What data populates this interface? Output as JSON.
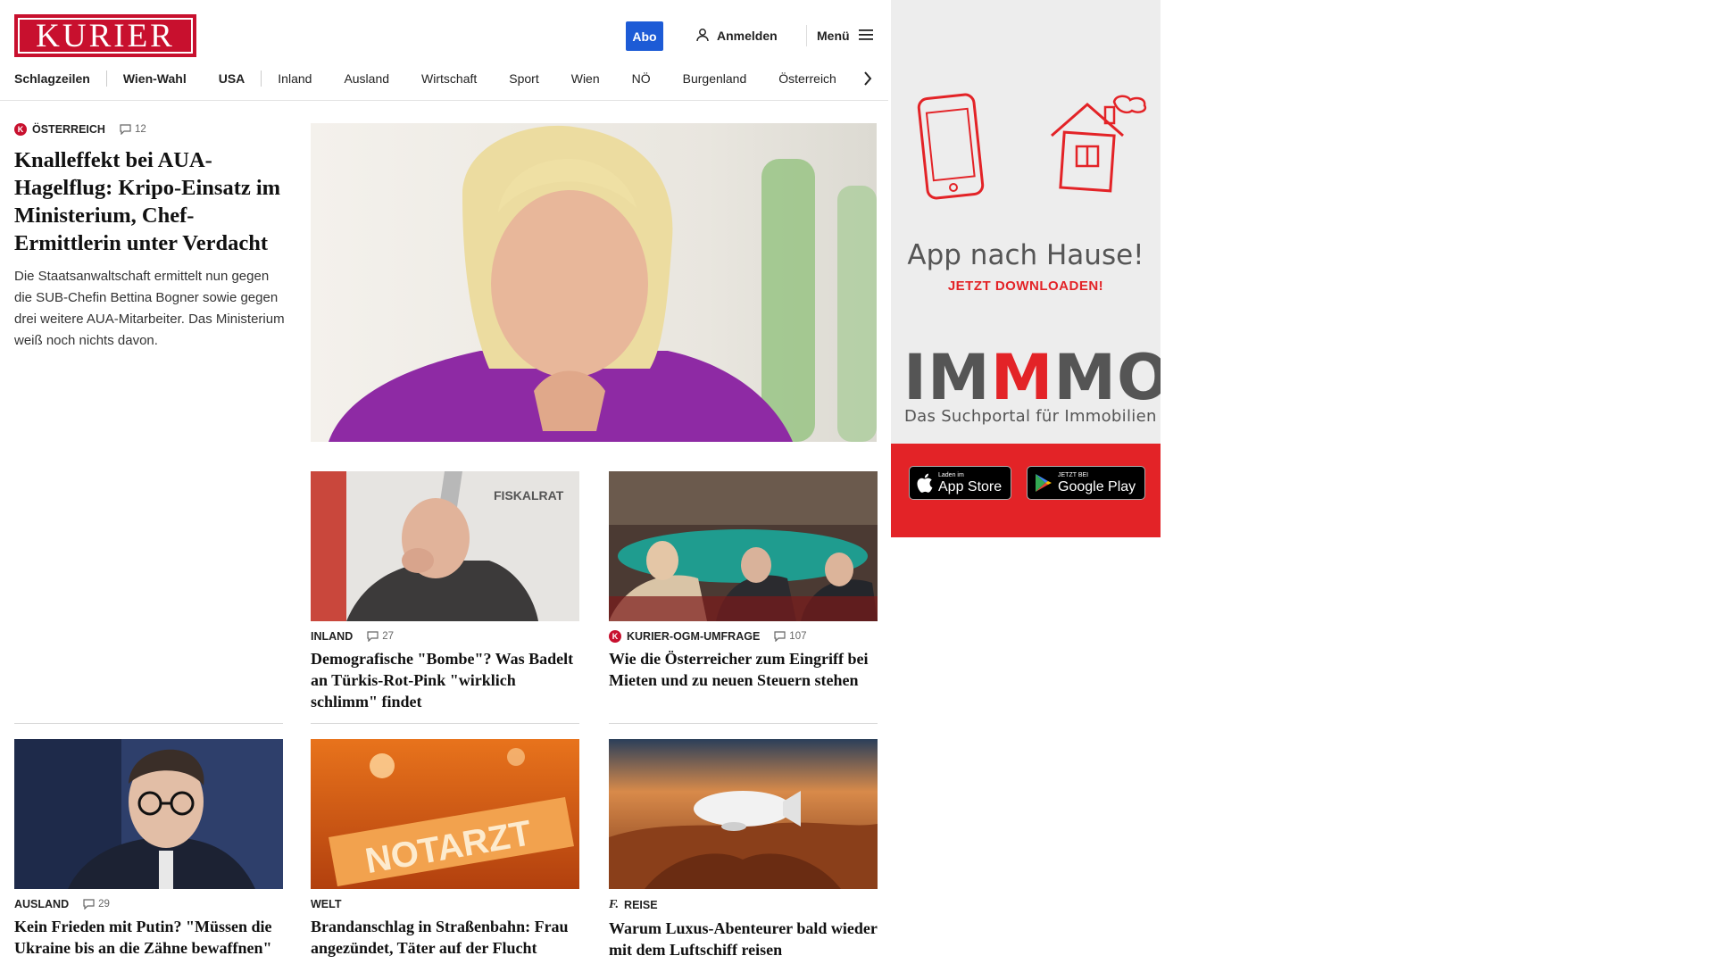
{
  "header": {
    "logo_text": "KURIER",
    "abo_label": "Abo",
    "login_label": "Anmelden",
    "menu_label": "Menü",
    "brand_color": "#c8102e",
    "accent_color": "#1d5bd6"
  },
  "nav": {
    "items": [
      "Schlagzeilen",
      "Wien-Wahl",
      "USA",
      "Inland",
      "Ausland",
      "Wirtschaft",
      "Sport",
      "Wien",
      "NÖ",
      "Burgenland",
      "Österreich"
    ]
  },
  "lead": {
    "category": "ÖSTERREICH",
    "comments": "12",
    "headline": "Knalleffekt bei AUA-Hagelflug: Kripo-Einsatz im Ministerium, Chef-Ermittlerin unter Verdacht",
    "teaser": "Die Staatsanwaltschaft ermittelt nun gegen die SUB-Chefin Bettina Bogner sowie gegen drei weitere AUA-Mitarbeiter. Das Ministerium weiß noch nichts davon."
  },
  "row1": [
    {
      "category": "INLAND",
      "comments": "27",
      "headline": "Demografische \"Bombe\"? Was Badelt an Türkis-Rot-Pink \"wirklich schlimm\" findet"
    },
    {
      "category": "KURIER-OGM-UMFRAGE",
      "comments": "107",
      "headline": "Wie die Österreicher zum Eingriff bei Mieten und zu neuen Steuern stehen"
    }
  ],
  "row2": [
    {
      "category": "AUSLAND",
      "comments": "29",
      "headline": "Kein Frieden mit Putin? \"Müssen die Ukraine bis an die Zähne bewaffnen\""
    },
    {
      "category": "WELT",
      "headline": "Brandanschlag in Straßenbahn: Frau angezündet, Täter auf der Flucht"
    },
    {
      "category": "REISE",
      "headline": "Warum Luxus-Abenteurer bald wieder mit dem Luftschiff reisen"
    }
  ],
  "ad": {
    "title": "App nach Hause!",
    "cta": "JETZT DOWNLOADEN!",
    "brand_prefix": "IM",
    "brand_red": "M",
    "brand_suffix": "MO",
    "subtitle": "Das Suchportal für Immobilien",
    "appstore_small": "Laden im",
    "appstore_big": "App Store",
    "googleplay_small": "JETZT BEI",
    "googleplay_big": "Google Play",
    "red_color": "#e32327"
  },
  "image_text": {
    "notarzt": "NOTARZT",
    "fiskalrat": "FISKALRAT"
  }
}
